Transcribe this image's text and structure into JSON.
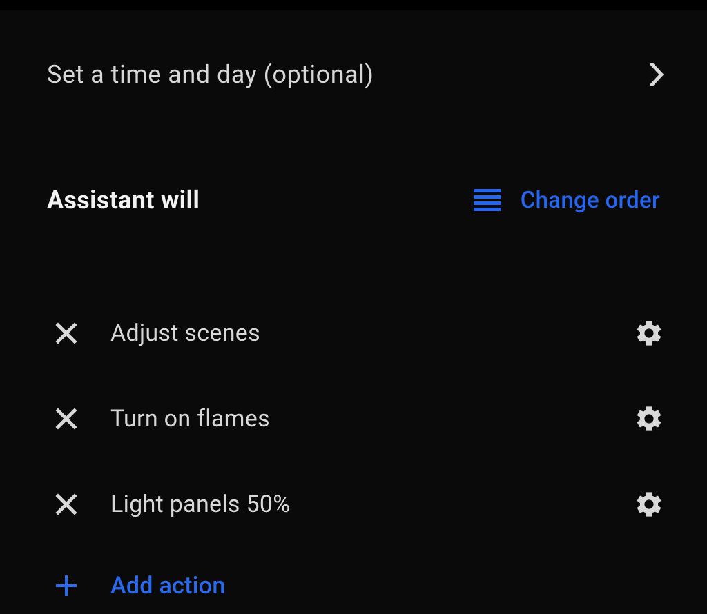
{
  "timeDay": {
    "label": "Set a time and day (optional)"
  },
  "section": {
    "title": "Assistant will",
    "changeOrderLabel": "Change order"
  },
  "actions": [
    {
      "label": "Adjust scenes"
    },
    {
      "label": "Turn on flames"
    },
    {
      "label": "Light panels 50%"
    }
  ],
  "addAction": {
    "label": "Add action"
  },
  "colors": {
    "accent": "#2a6af0",
    "text": "#d8d8d8",
    "heading": "#f2f2f2"
  }
}
